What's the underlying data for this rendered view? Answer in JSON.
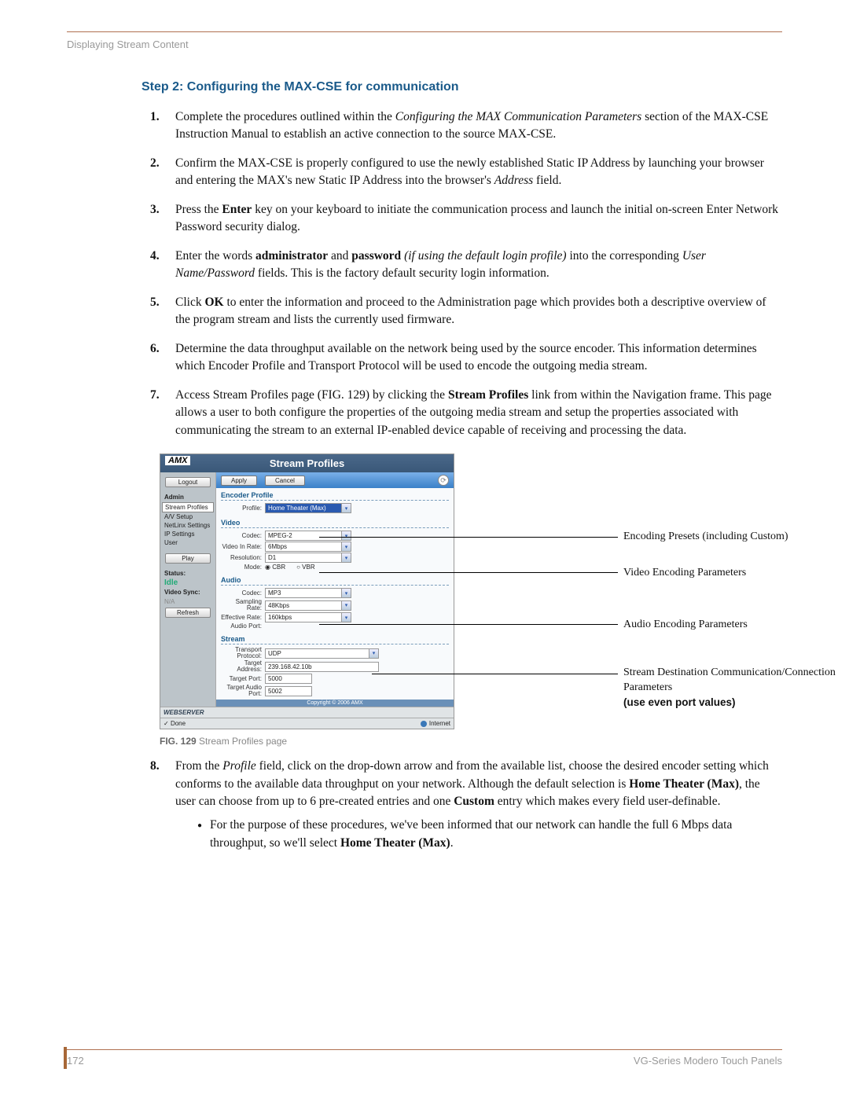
{
  "header": {
    "section": "Displaying Stream Content"
  },
  "title": "Step 2: Configuring the MAX-CSE for communication",
  "list": {
    "i1a": "Complete the procedures outlined within the ",
    "i1b": "Configuring the MAX Communication Parameters",
    "i1c": " section of the MAX-CSE Instruction Manual to establish an active connection to the source MAX-CSE.",
    "i2a": "Confirm the MAX-CSE is properly configured to use the newly established Static IP Address by launching your browser and entering the MAX's new Static IP Address into the browser's ",
    "i2b": "Address",
    "i2c": " field.",
    "i3a": "Press the ",
    "i3b": "Enter",
    "i3c": " key on your keyboard to initiate the communication process and launch the initial on-screen Enter Network Password security dialog.",
    "i4a": "Enter the words ",
    "i4b": "administrator",
    "i4c": " and ",
    "i4d": "password",
    "i4e": " (if using the default login profile)",
    "i4f": " into the corresponding ",
    "i4g": "User Name/Password",
    "i4h": " fields. This is the factory default security login information.",
    "i5a": "Click ",
    "i5b": "OK",
    "i5c": " to enter the information and proceed to the Administration page which provides both a descriptive overview of the program stream and lists the currently used firmware.",
    "i6": "Determine the data throughput available on the network being used by the source encoder. This information determines which Encoder Profile and Transport Protocol will be used to encode the outgoing media stream.",
    "i7a": "Access Stream Profiles page (FIG. 129) by clicking the ",
    "i7b": "Stream Profiles",
    "i7c": " link from within the Navigation frame. This page allows a user to both configure the properties of the outgoing media stream and setup the properties associated with communicating the stream to an external IP-enabled device capable of receiving and processing the data.",
    "i8a": "From the ",
    "i8b": "Profile",
    "i8c": " field, click on the drop-down arrow and from the available list, choose the desired encoder setting which conforms to the available data throughput on your network. Although the default selection is ",
    "i8d": "Home Theater (Max)",
    "i8e": ", the user can choose from up to 6 pre-created entries and one ",
    "i8f": "Custom",
    "i8g": " entry which makes every field user-definable.",
    "bullet_a": "For the purpose of these procedures, we've been informed that our network can handle the full 6 Mbps data throughput, so we'll select ",
    "bullet_b": "Home Theater (Max)",
    "bullet_c": "."
  },
  "fig": {
    "caption_b": "FIG. 129",
    "caption_t": "  Stream Profiles page",
    "header_title": "Stream Profiles",
    "logo": "AMX",
    "logout": "Logout",
    "apply": "Apply",
    "cancel": "Cancel",
    "sidebar": {
      "admin": "Admin",
      "stream_profiles": "Stream Profiles",
      "av_setup": "A/V Setup",
      "netlinx": "NetLinx Settings",
      "ip_settings": "IP Settings",
      "user": "User",
      "play": "Play",
      "status": "Status:",
      "idle": "Idle",
      "video_sync": "Video Sync:",
      "na": "N/A",
      "refresh": "Refresh"
    },
    "enc": {
      "title": "Encoder Profile",
      "profile_lbl": "Profile:",
      "profile_val": "Home Theater (Max)"
    },
    "video": {
      "title": "Video",
      "codec_lbl": "Codec:",
      "codec_val": "MPEG-2",
      "rate_lbl": "Video In Rate:",
      "rate_val": "6Mbps",
      "res_lbl": "Resolution:",
      "res_val": "D1",
      "mode_lbl": "Mode:",
      "cbr": "CBR",
      "vbr": "VBR"
    },
    "audio": {
      "title": "Audio",
      "codec_lbl": "Codec:",
      "codec_val": "MP3",
      "samp_lbl": "Sampling Rate:",
      "samp_val": "48Kbps",
      "eff_lbl": "Effective Rate:",
      "eff_val": "160kbps",
      "aport_lbl": "Audio Port:"
    },
    "stream": {
      "title": "Stream",
      "proto_lbl": "Transport Protocol:",
      "proto_val": "UDP",
      "addr_lbl": "Target Address:",
      "addr_val": "239.168.42.10b",
      "port_lbl": "Target Port:",
      "port_val": "5000",
      "aport_lbl": "Target Audio Port:",
      "aport_val": "5002"
    },
    "footer_copy": "Copyright © 2006 AMX",
    "webserver": "WEBSERVER",
    "done": "Done",
    "internet": "Internet"
  },
  "callouts": {
    "c1": "Encoding Presets (including Custom)",
    "c2": "Video Encoding Parameters",
    "c3": "Audio Encoding Parameters",
    "c4a": "Stream Destination Communication/Connection Parameters",
    "c4b": "(use even port values)"
  },
  "footer": {
    "page": "172",
    "doc": "VG-Series Modero Touch Panels"
  }
}
